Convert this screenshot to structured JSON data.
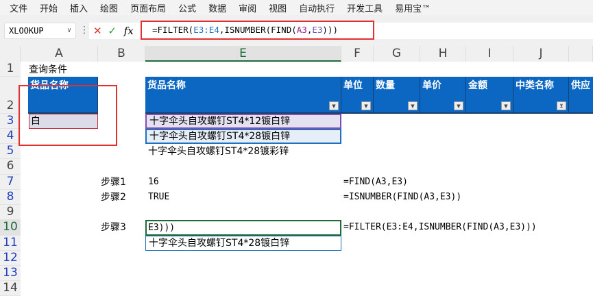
{
  "menu": [
    "文件",
    "开始",
    "插入",
    "绘图",
    "页面布局",
    "公式",
    "数据",
    "审阅",
    "视图",
    "自动执行",
    "开发工具",
    "易用宝™"
  ],
  "name_box": "XLOOKUP",
  "formula_bar": {
    "prefix": "=FILTER(",
    "r1": "E3:E4",
    "mid": ",ISNUMBER(FIND(",
    "r2": "A3",
    "comma": ",",
    "r3": "E3",
    "suffix": ")))"
  },
  "columns": [
    "A",
    "B",
    "E",
    "F",
    "G",
    "H",
    "I",
    "J"
  ],
  "rows": [
    "1",
    "2",
    "3",
    "4",
    "5",
    "6",
    "7",
    "8",
    "9",
    "10",
    "11",
    "12",
    "13",
    "14"
  ],
  "cells": {
    "A1": "查询条件",
    "A2": "货品名称",
    "A3": "白",
    "headers": [
      "货品名称",
      "单位",
      "数量",
      "单价",
      "金额",
      "中类名称",
      "供应"
    ],
    "E3": "十字伞头自攻螺钉ST4*12镀白锌",
    "E4": "十字伞头自攻螺钉ST4*28镀白锌",
    "E5": "十字伞头自攻螺钉ST4*28镀彩锌",
    "B7": "步骤1",
    "E7": "16",
    "F7": "=FIND(A3,E3)",
    "B8": "步骤2",
    "E8": "TRUE",
    "F8": "=ISNUMBER(FIND(A3,E3))",
    "B10": "步骤3",
    "E10": "E3)))",
    "F10": "=FILTER(E3:E4,ISNUMBER(FIND(A3,E3)))",
    "E11": "十字伞头自攻螺钉ST4*28镀白锌"
  }
}
